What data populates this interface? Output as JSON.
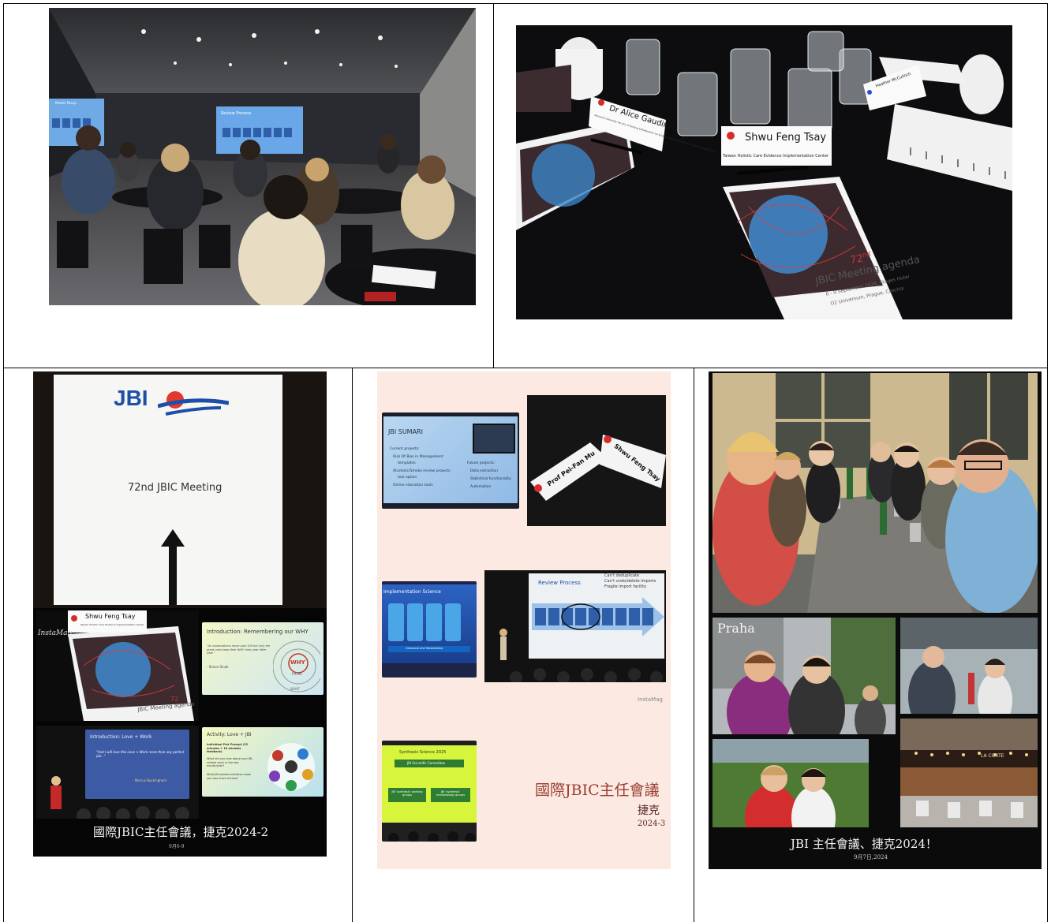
{
  "top_left": {
    "screen_left": "Master Pasujc",
    "screen_right": "Review Process"
  },
  "top_right": {
    "place_card_1_name": "Dr Alice Gaudine",
    "place_card_1_sub": "Memorial University Faculty of Nursing Collaboration for Evidence-Based Nursing and Primary Health Care",
    "place_card_2_name": "Shwu Feng Tsay",
    "place_card_2_sub": "Taiwan Holistic Care Evidence Implementation Center",
    "place_card_3_name": "Heather McCulloch",
    "agenda_num": "72",
    "agenda_sup": "nd",
    "agenda_title": "JBIC Meeting agenda",
    "agenda_date": "6 - 9 September 2024, Stages Hotel",
    "agenda_venue": "O2 Universum, Prague, Czechia"
  },
  "collage1": {
    "logo": "JBI",
    "meeting": "72nd JBIC Meeting",
    "card_name": "Shwu Feng Tsay",
    "card_sub": "Taiwan Holistic Care Evidence Implementation Center",
    "watermark": "InstaMag",
    "agenda_num": "72",
    "agenda_title": "JBIC Meeting agenda",
    "slide1_title": "Introduction: Remembering our WHY",
    "slide1_quote": "\"As organizations move past 100 but only the great ones keep their WHY clear year after year.\"",
    "slide1_author": "- Simon Sinek",
    "why": "WHY",
    "how": "HOW",
    "what": "WHAT",
    "slide2_title": "Introduction: Love + Work",
    "slide2_quote": "\"And I will love this Love + Work more than any perfect job...\"",
    "slide2_author": "- Marcus Buckingham",
    "slide3_title": "Activity: Love + JBI",
    "slide3_sub": "Individual Pair Prompt (15 minutes + 10 minutes feedback)",
    "slide3_b1": "What did you love about your JBI-related work in the last month/year?",
    "slide3_b2": "What JBI-related activities make you lose track of time?",
    "caption": "國際JBIC主任會議，捷克2024-2",
    "date": "9月6-9"
  },
  "collage2": {
    "sumari_title": "JBI SUMARI",
    "sumari_l1": "Current projects:",
    "sumari_l2": "Risk Of Bias in Management",
    "sumari_l3": "templates",
    "sumari_l4": "Alcoholic/Smoke review projects",
    "sumari_l5": "tool option",
    "sumari_l6": "Online education tools",
    "sumari_r1": "Future projects:",
    "sumari_r2": "Data extraction",
    "sumari_r3": "Statistical functionality",
    "sumari_r4": "Automation",
    "card1": "Prof Pei-Fan Mu",
    "card2": "Shwu Feng Tsay",
    "impl_title": "Implementation Science",
    "impl_band": "Grassroot and Stewardship",
    "review_title": "Review Process",
    "review_n1": "Can't deduplicate",
    "review_n2": "Can't undo/delete imports",
    "review_n3": "Fragile import facility",
    "watermark": "InstaMag",
    "synth_title": "Synthesis Science 2025",
    "synth_box": "JBI Scientific Committee",
    "synth_l": "JBI 'synthesis' working groups",
    "synth_r": "JBI 'synthesis' methodology groups",
    "caption": "國際JBIC主任會議",
    "country": "捷克",
    "date": "2024-3"
  },
  "collage3": {
    "praha": "Praha",
    "sign": "LA CORTE",
    "caption": "JBI 主任會議、捷克2024！",
    "date": "9月7日,2024"
  }
}
